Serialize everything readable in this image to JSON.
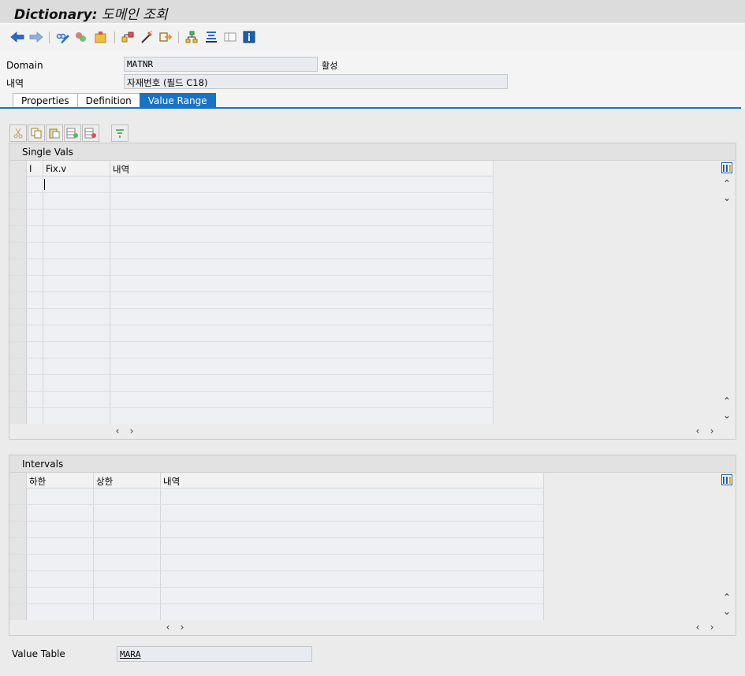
{
  "window": {
    "title_main": "Dictionary:",
    "title_sub": " 도메인 조회"
  },
  "toolbar": {
    "icons": [
      "back-icon",
      "forward-icon",
      "other-object-icon",
      "display-change-icon",
      "activate-icon",
      "where-used-icon",
      "object-list-icon",
      "navigate-icon",
      "hierarchy-icon",
      "configure-icon",
      "layout-icon",
      "info-icon"
    ]
  },
  "header": {
    "domain_label": "Domain",
    "domain_value": "MATNR",
    "status": "활성",
    "desc_label": "내역",
    "desc_value": "자재번호 (필드 C18)"
  },
  "tabs": [
    {
      "label": "Properties",
      "active": false
    },
    {
      "label": "Definition",
      "active": false
    },
    {
      "label": "Value Range",
      "active": true
    }
  ],
  "single_vals": {
    "title": "Single Vals",
    "columns": [
      "I",
      "Fix.v",
      "내역"
    ],
    "row_count": 15
  },
  "intervals": {
    "title": "Intervals",
    "columns": [
      "하한",
      "상한",
      "내역"
    ],
    "row_count": 8
  },
  "value_table": {
    "label": "Value Table",
    "value": "MARA"
  },
  "colors": {
    "accent": "#1873c4",
    "title_bg": "#dcdcdc",
    "grid_bg": "#eef0f3"
  }
}
